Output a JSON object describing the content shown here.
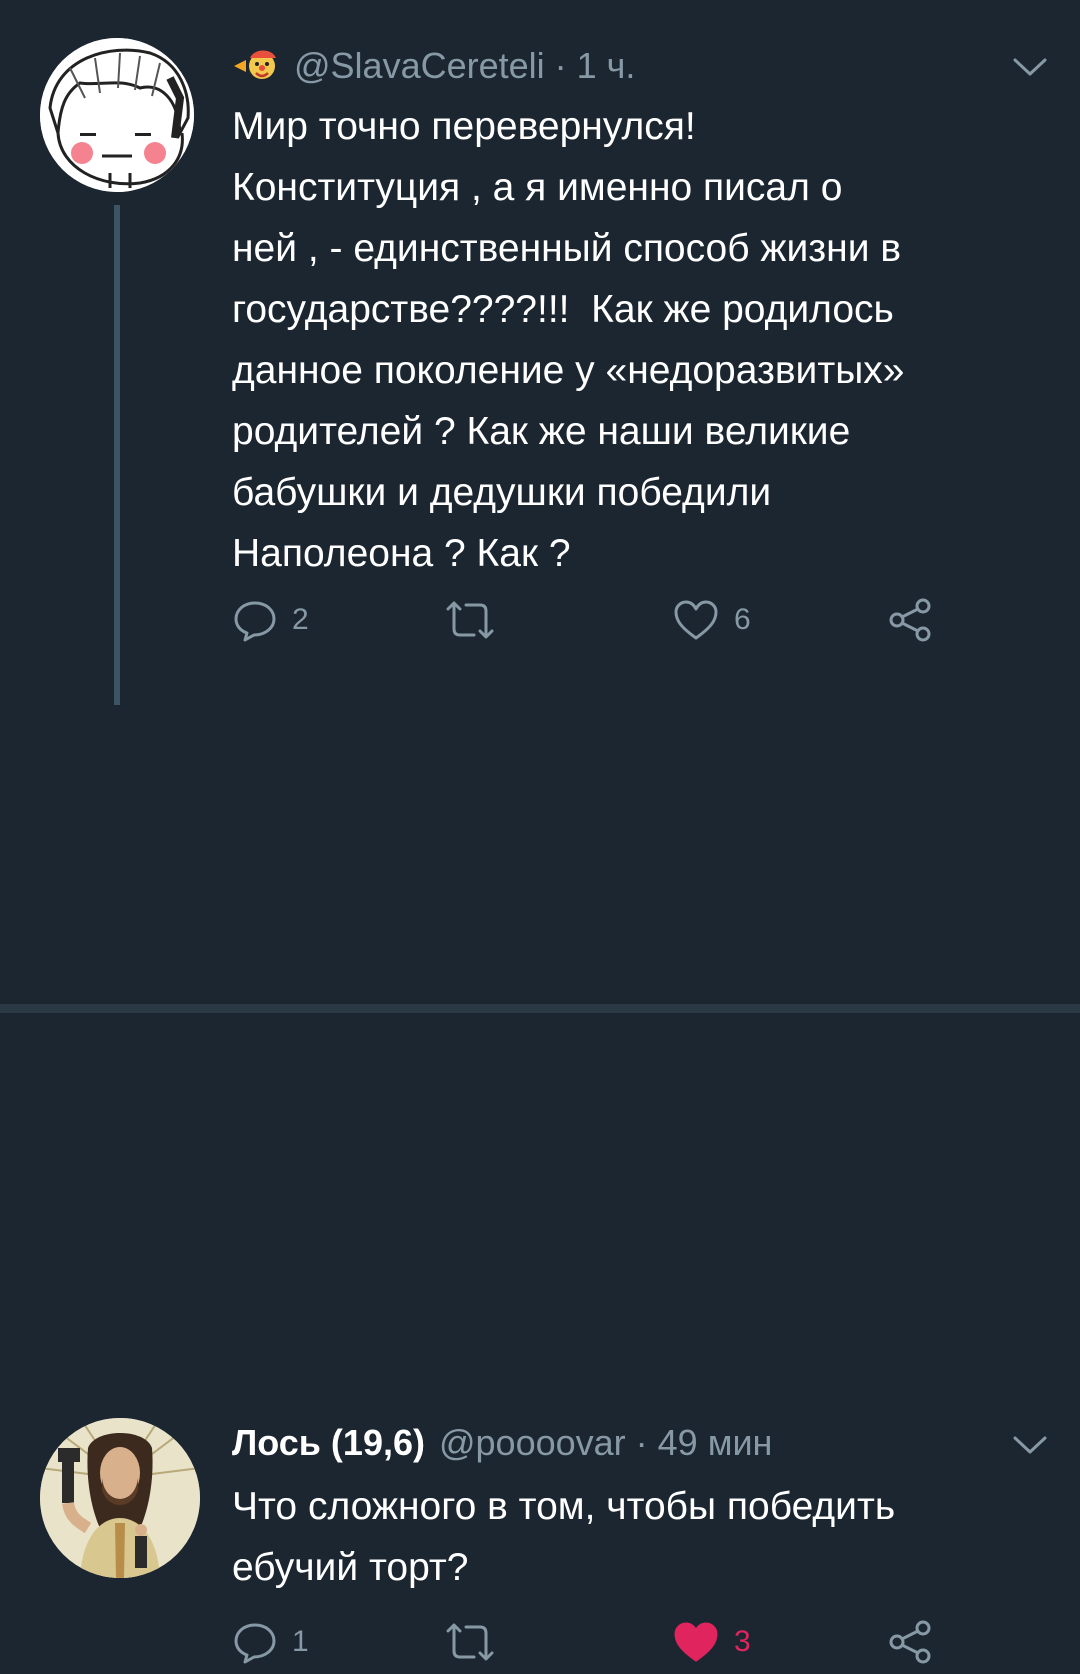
{
  "colors": {
    "background": "#1b2631",
    "text": "#ffffff",
    "secondary": "#8899a6",
    "like_active": "#e0245e"
  },
  "tweets": [
    {
      "display_name": "",
      "name_emoji": "clown-emoji-icon",
      "handle": "@SlavaCereteli",
      "separator": "·",
      "time": "1 ч.",
      "text": "Мир точно перевернулся!\nКонституция , а я именно писал о\nней , - единственный способ жизни в\nгосударстве????!!!  Как же родилось\nданное поколение у «недоразвитых»\nродителей ? Как же наши великие\nбабушки и дедушки победили\nНаполеона ? Как ?",
      "replies": "2",
      "retweets": "",
      "likes": "6",
      "liked": false
    },
    {
      "display_name": "Лось (19,6)",
      "handle": "@poooovar",
      "separator": "·",
      "time": "49 мин",
      "text": "Что сложного в том, чтобы победить\nебучий торт?",
      "replies": "1",
      "retweets": "",
      "likes": "3",
      "liked": true
    }
  ]
}
